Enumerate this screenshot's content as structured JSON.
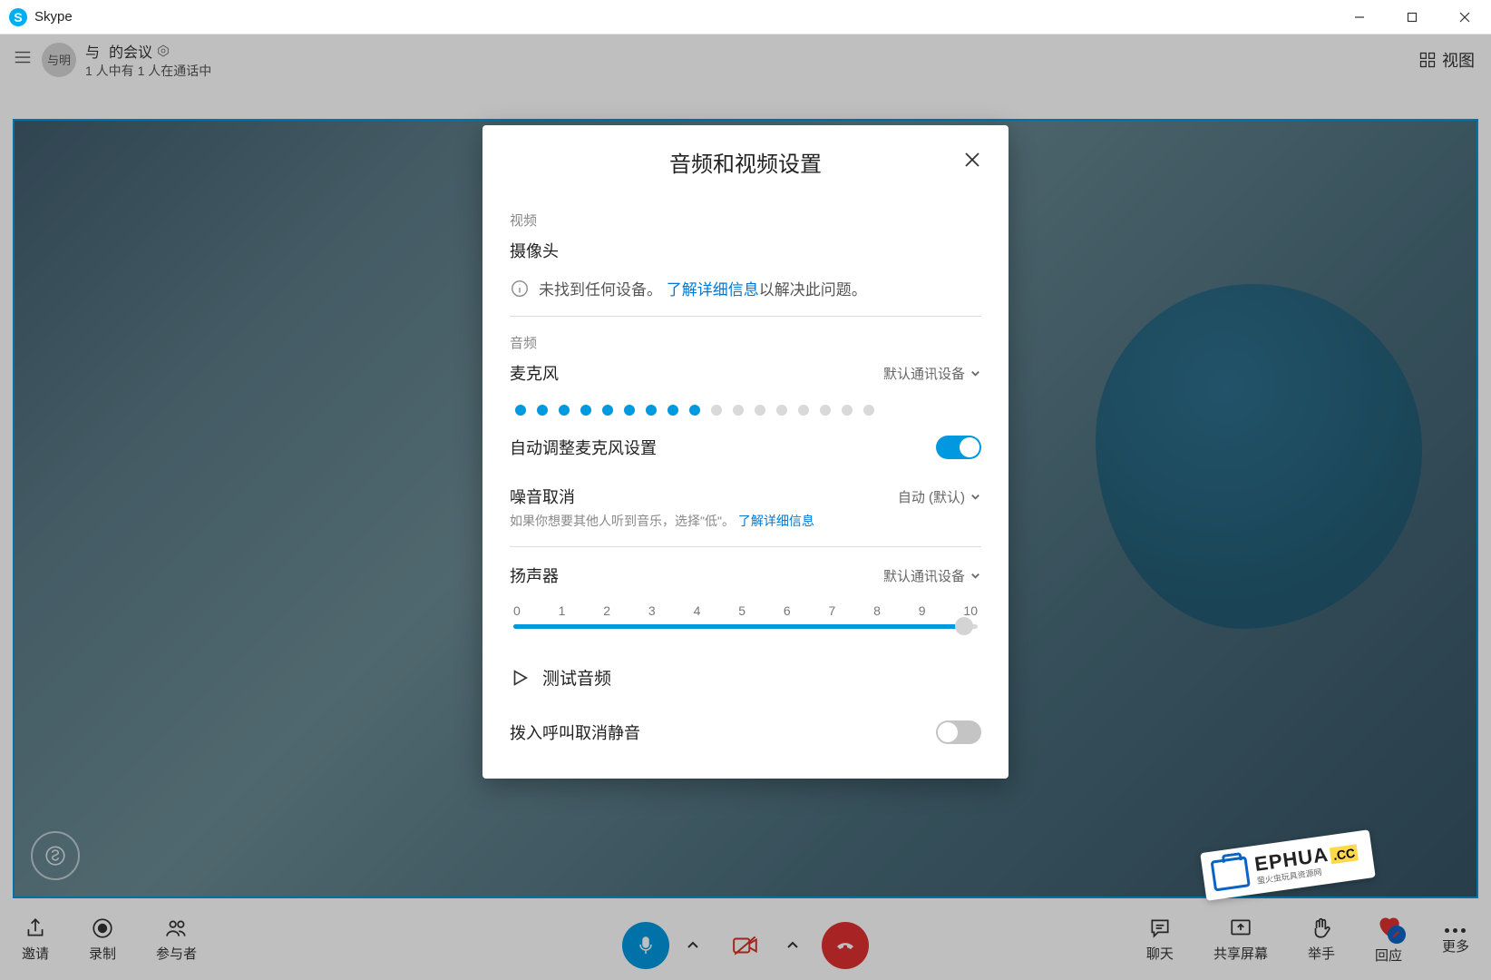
{
  "window": {
    "title": "Skype"
  },
  "header": {
    "avatar_text": "与明",
    "line1_prefix": "与",
    "line1_blurred": "      ",
    "line1_suffix": "的会议",
    "line2": "1 人中有 1 人在通话中",
    "view_label": "视图"
  },
  "modal": {
    "title": "音频和视频设置",
    "video_section": "视频",
    "camera_label": "摄像头",
    "no_device_text": "未找到任何设备。",
    "learn_more": "了解详细信息",
    "no_device_suffix": "以解决此问题。",
    "audio_section": "音频",
    "mic_label": "麦克风",
    "mic_device": "默认通讯设备",
    "mic_level_active": 9,
    "mic_level_total": 17,
    "auto_mic_label": "自动调整麦克风设置",
    "noise_cancel_label": "噪音取消",
    "noise_cancel_value": "自动 (默认)",
    "noise_cancel_desc_prefix": "如果你想要其他人听到音乐，选择\"低\"。",
    "noise_cancel_link": "了解详细信息",
    "speaker_label": "扬声器",
    "speaker_device": "默认通讯设备",
    "slider_ticks": [
      "0",
      "1",
      "2",
      "3",
      "4",
      "5",
      "6",
      "7",
      "8",
      "9",
      "10"
    ],
    "test_audio": "测试音频",
    "unmute_incoming": "拨入呼叫取消静音"
  },
  "toolbar": {
    "invite": "邀请",
    "record": "录制",
    "participants": "参与者",
    "chat": "聊天",
    "share": "共享屏幕",
    "raise_hand": "举手",
    "react": "回应",
    "more": "更多"
  },
  "watermark": {
    "brand": "EPHUA",
    "domain": ".CC",
    "sub": "萤火虫玩具资源网"
  }
}
